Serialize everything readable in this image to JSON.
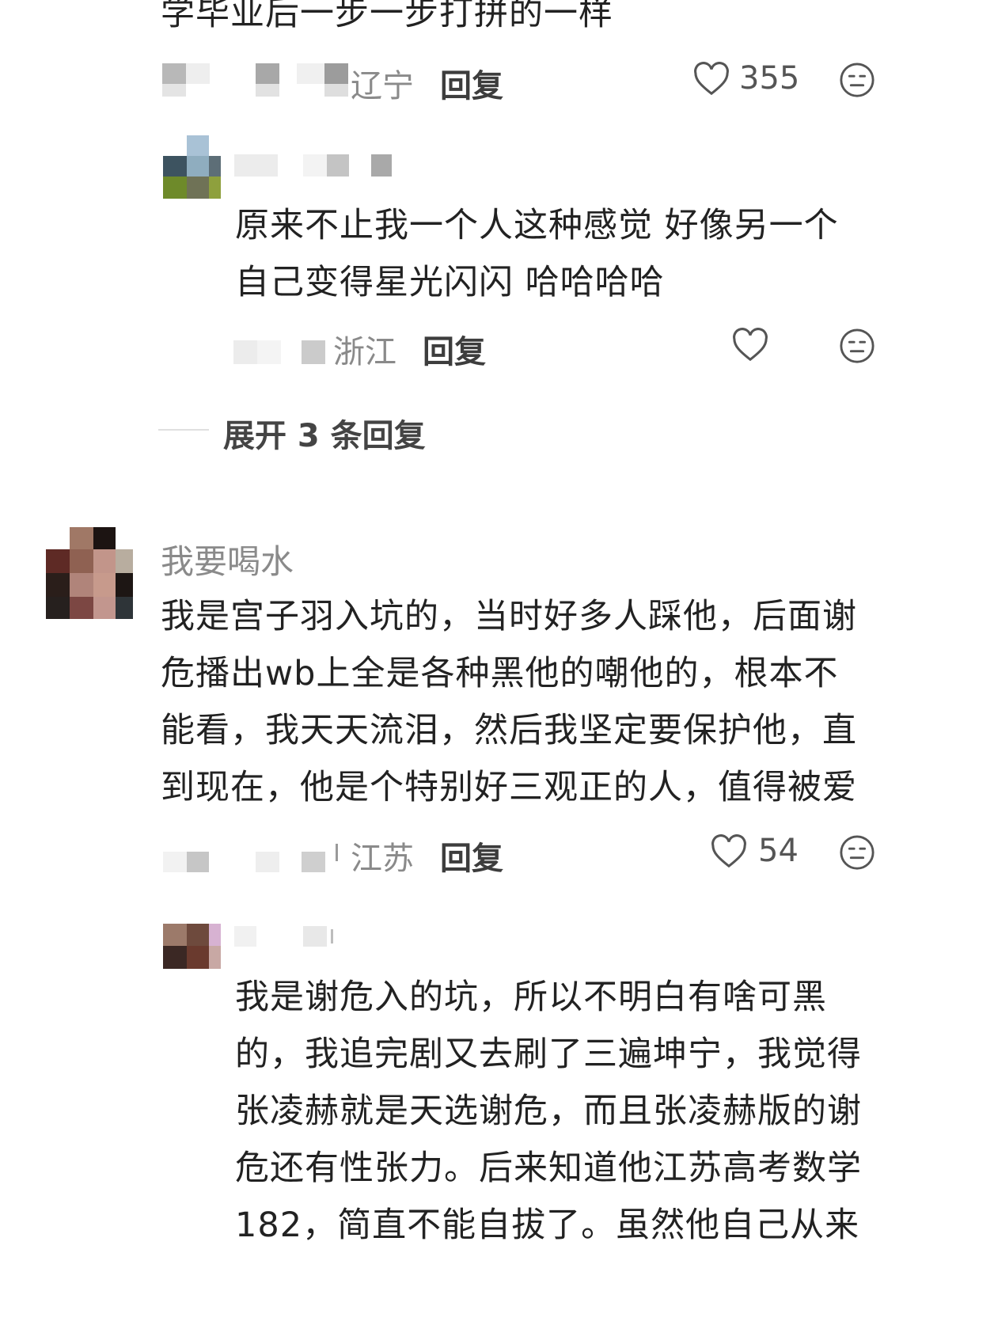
{
  "comments": [
    {
      "text": "学毕业后一步一步打拼的一样",
      "location": "辽宁",
      "reply_label": "回复",
      "likes": "355",
      "icons": {
        "like": "heart-outline-icon",
        "dislike": "meh-face-icon"
      }
    },
    {
      "text_lines": [
        "原来不止我一个人这种感觉 好像另一个",
        "自己变得星光闪闪 哈哈哈哈"
      ],
      "location": "浙江",
      "reply_label": "回复",
      "icons": {
        "like": "heart-outline-icon",
        "dislike": "meh-face-icon"
      }
    },
    {
      "expand_label": "展开 3 条回复"
    },
    {
      "username": "我要喝水",
      "text_lines": [
        "我是宫子羽入坑的，当时好多人踩他，后面谢",
        "危播出wb上全是各种黑他的嘲他的，根本不",
        "能看，我天天流泪，然后我坚定要保护他，直",
        "到现在，他是个特别好三观正的人，值得被爱"
      ],
      "location": "江苏",
      "reply_label": "回复",
      "likes": "54",
      "icons": {
        "like": "heart-outline-icon",
        "dislike": "meh-face-icon"
      }
    },
    {
      "text_lines": [
        "我是谢危入的坑，所以不明白有啥可黑",
        "的，我追完剧又去刷了三遍坤宁，我觉得",
        "张凌赫就是天选谢危，而且张凌赫版的谢",
        "危还有性张力。后来知道他江苏高考数学",
        "182，简直不能自拔了。虽然他自己从来"
      ]
    }
  ],
  "colors": {
    "background": "#ffffff",
    "text": "#222222",
    "meta": "#8a8a8a",
    "icon": "#555555"
  }
}
